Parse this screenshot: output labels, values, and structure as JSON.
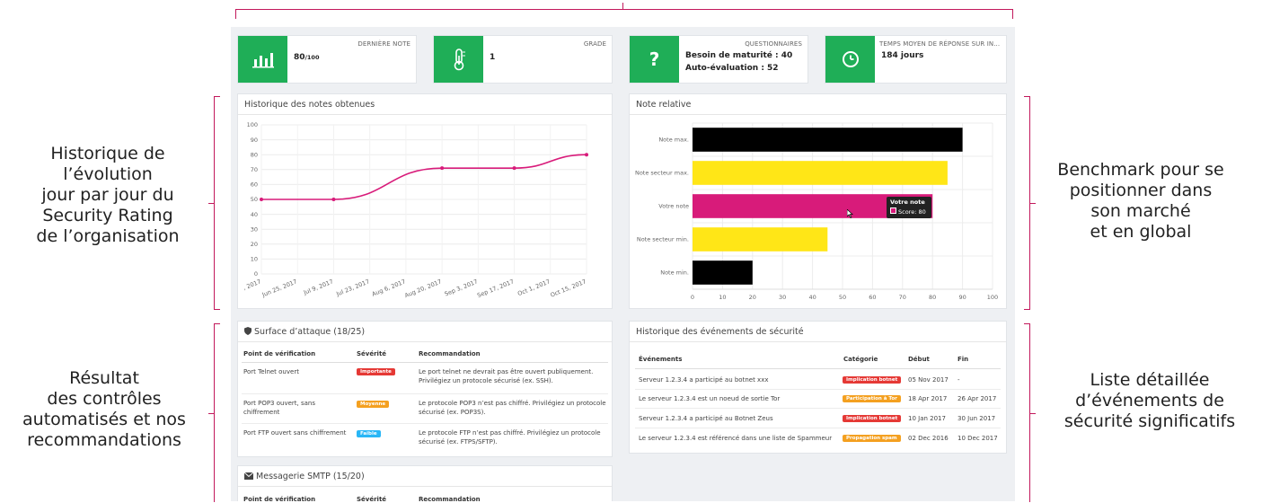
{
  "annotations": {
    "left_top": [
      "Historique de",
      "l’évolution",
      "jour par jour du",
      "Security Rating",
      "de l’organisation"
    ],
    "right_top": [
      "Benchmark pour se",
      "positionner dans",
      "son marché",
      "et en global"
    ],
    "left_bottom": [
      "Résultat",
      "des contrôles",
      "automatisés et nos",
      "recommandations"
    ],
    "right_bottom": [
      "Liste détaillée",
      "d’événements de",
      "sécurité significatifs"
    ]
  },
  "stats": {
    "last_score": {
      "label": "DERNIÈRE NOTE",
      "value": "80",
      "suffix": "/100",
      "icon": "bar-chart-icon"
    },
    "grade": {
      "label": "GRADE",
      "value": "1",
      "icon": "thermometer-icon"
    },
    "questionnaires": {
      "label": "QUESTIONNAIRES",
      "line1": "Besoin de maturité : 40",
      "line2": "Auto-évaluation : 52",
      "icon": "question-icon"
    },
    "response_time": {
      "label": "TEMPS MOYEN DE RÉPONSE SUR IN...",
      "value": "184 jours",
      "icon": "clock-icon"
    }
  },
  "history_panel": {
    "title": "Historique des notes obtenues"
  },
  "relative_panel": {
    "title": "Note relative",
    "tooltip_title": "Votre note",
    "tooltip_value": "Score: 80"
  },
  "chart_data": [
    {
      "type": "line",
      "title": "Historique des notes obtenues",
      "x": [
        ", 2017",
        "Jun 25, 2017",
        "Jul 9, 2017",
        "Jul 23, 2017",
        "Aug 6, 2017",
        "Aug 20, 2017",
        "Sep 3, 2017",
        "Sep 17, 2017",
        "Oct 1, 2017",
        "Oct 15, 2017"
      ],
      "points": [
        {
          "x": ", 2017",
          "y": 50
        },
        {
          "x": "Jul 9, 2017",
          "y": 50
        },
        {
          "x": "Aug 20, 2017",
          "y": 71
        },
        {
          "x": "Sep 17, 2017",
          "y": 71
        },
        {
          "x": "Oct 15, 2017",
          "y": 80
        }
      ],
      "yticks": [
        0,
        10,
        20,
        30,
        40,
        50,
        60,
        70,
        80,
        90,
        100
      ],
      "ylim": [
        0,
        100
      ],
      "color": "#d81b7a",
      "grid": true
    },
    {
      "type": "bar",
      "orientation": "horizontal",
      "title": "Note relative",
      "categories": [
        "Note max.",
        "Note secteur max.",
        "Votre note",
        "Note secteur min.",
        "Note min."
      ],
      "values": [
        90,
        85,
        80,
        45,
        20
      ],
      "colors": [
        "#000000",
        "#ffe617",
        "#d81b7a",
        "#ffe617",
        "#000000"
      ],
      "xticks": [
        0,
        10,
        20,
        30,
        40,
        50,
        60,
        70,
        80,
        90,
        100
      ],
      "xlim": [
        0,
        100
      ],
      "grid": true
    }
  ],
  "attack_surface": {
    "title": "Surface d’attaque (18/25)",
    "headers": [
      "Point de vérification",
      "Sévérité",
      "Recommandation"
    ],
    "rows": [
      {
        "point": "Port Telnet ouvert",
        "severity": "Importante",
        "color": "#e53935",
        "rec": "Le port telnet ne devrait pas être ouvert publiquement. Privilégiez un protocole sécurisé (ex. SSH)."
      },
      {
        "point": "Port POP3 ouvert, sans chiffrement",
        "severity": "Moyenne",
        "color": "#f4a020",
        "rec": "Le protocole POP3 n’est pas chiffré. Privilégiez un protocole sécurisé (ex. POP3S)."
      },
      {
        "point": "Port FTP ouvert sans chiffrement",
        "severity": "Faible",
        "color": "#29b6f6",
        "rec": "Le protocole FTP n’est pas chiffré. Privilégiez un protocole sécurisé (ex. FTPS/SFTP)."
      }
    ]
  },
  "smtp": {
    "title": "Messagerie SMTP (15/20)",
    "headers": [
      "Point de vérification",
      "Sévérité",
      "Recommandation"
    ]
  },
  "events": {
    "title": "Historique des événements de sécurité",
    "headers": [
      "Événements",
      "Catégorie",
      "Début",
      "Fin"
    ],
    "rows": [
      {
        "event": "Serveur 1.2.3.4 a participé au botnet xxx",
        "category": "Implication botnet",
        "color": "#e53935",
        "start": "05 Nov 2017",
        "end": "-"
      },
      {
        "event": "Le serveur 1.2.3.4 est un noeud de sortie Tor",
        "category": "Participation à Tor",
        "color": "#f4a020",
        "start": "18 Apr 2017",
        "end": "26 Apr 2017"
      },
      {
        "event": "Serveur 1.2.3.4 a participé au Botnet Zeus",
        "category": "Implication botnet",
        "color": "#e53935",
        "start": "10 Jan 2017",
        "end": "30 Jun 2017"
      },
      {
        "event": "Le serveur 1.2.3.4 est référencé dans une liste de Spammeur",
        "category": "Propagation spam",
        "color": "#f4a020",
        "start": "02 Dec 2016",
        "end": "10 Dec 2017"
      }
    ]
  }
}
